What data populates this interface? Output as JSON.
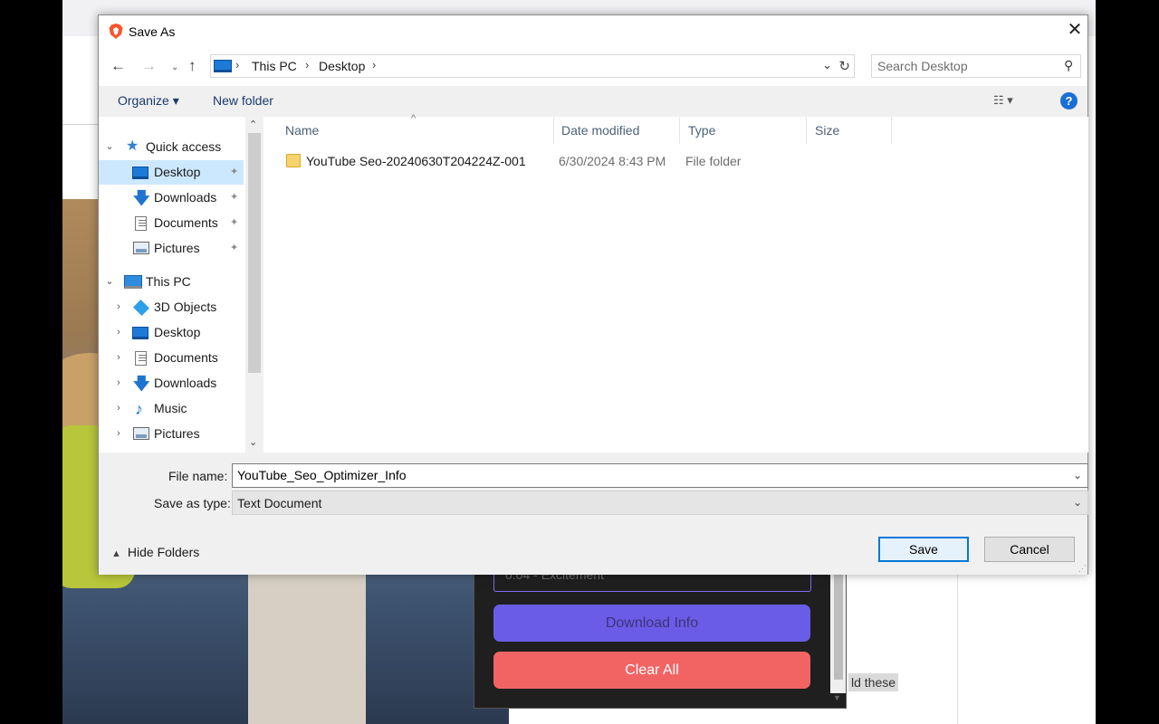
{
  "background": {
    "snippet_text": "ld these",
    "extension": {
      "partial_field_text": "0:04 - Excitement",
      "download_label": "Download Info",
      "clear_label": "Clear All",
      "colors": {
        "download": "#6b5ce7",
        "clear": "#f26464",
        "panel": "#1f1f1f"
      }
    }
  },
  "dialog": {
    "title": "Save As",
    "close_glyph": "✕",
    "nav": {
      "back_glyph": "←",
      "forward_glyph": "→",
      "recent_glyph": "⌄",
      "up_glyph": "↑",
      "breadcrumb": [
        "This PC",
        "Desktop"
      ],
      "breadcrumb_sep": "›",
      "dropdown_glyph": "⌄",
      "refresh_glyph": "↻",
      "search_placeholder": "Search Desktop"
    },
    "toolbar": {
      "organize_label": "Organize ▾",
      "new_folder_label": "New folder",
      "view_glyph": "☷ ▾",
      "help_glyph": "?"
    },
    "nav_pane": {
      "quick_access": {
        "label": "Quick access",
        "icon": "star-icon",
        "items": [
          {
            "label": "Desktop",
            "icon": "desktop-icon",
            "pinned": true,
            "selected": true
          },
          {
            "label": "Downloads",
            "icon": "downloads-icon",
            "pinned": true
          },
          {
            "label": "Documents",
            "icon": "documents-icon",
            "pinned": true
          },
          {
            "label": "Pictures",
            "icon": "pictures-icon",
            "pinned": true
          }
        ]
      },
      "this_pc": {
        "label": "This PC",
        "icon": "computer-icon",
        "items": [
          {
            "label": "3D Objects",
            "icon": "3d-objects-icon"
          },
          {
            "label": "Desktop",
            "icon": "desktop-icon"
          },
          {
            "label": "Documents",
            "icon": "documents-icon"
          },
          {
            "label": "Downloads",
            "icon": "downloads-icon"
          },
          {
            "label": "Music",
            "icon": "music-icon"
          },
          {
            "label": "Pictures",
            "icon": "pictures-icon"
          }
        ]
      },
      "pin_glyph": "📌",
      "chevron_open": "⌄",
      "chevron_closed": "›"
    },
    "columns": [
      "Name",
      "Date modified",
      "Type",
      "Size"
    ],
    "sort_glyph": "^",
    "files": [
      {
        "name": "YouTube Seo-20240630T204224Z-001",
        "date": "6/30/2024 8:43 PM",
        "type": "File folder",
        "size": ""
      }
    ],
    "file_name_label": "File name:",
    "file_name_value": "YouTube_Seo_Optimizer_Info",
    "save_type_label": "Save as type:",
    "save_type_value": "Text Document",
    "hide_folders_label": "Hide Folders",
    "save_label": "Save",
    "cancel_label": "Cancel",
    "accent_color": "#0078d7",
    "selection_color": "#cce8ff"
  }
}
